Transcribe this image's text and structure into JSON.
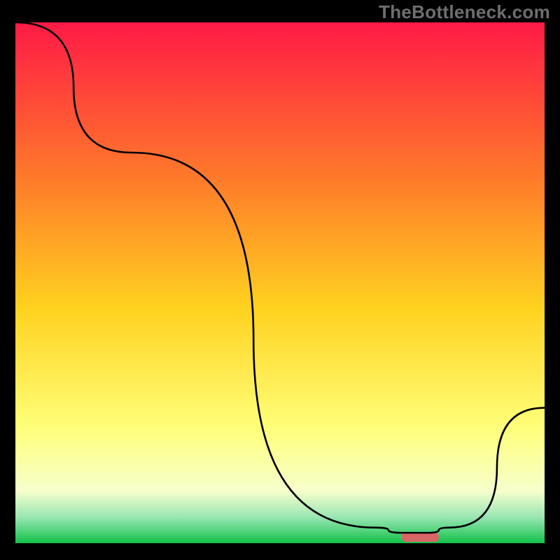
{
  "watermark": "TheBottleneck.com",
  "colors": {
    "frame": "#000000",
    "curve": "#000000",
    "marker": "#d96666",
    "grad_top": "#ff1a46",
    "grad_mid1": "#ff7a2a",
    "grad_mid2": "#ffd21f",
    "grad_mid3": "#ffff7a",
    "grad_mid4": "#f6ffcc",
    "grad_green_top": "#99e6b3",
    "grad_green_bot": "#12c24a"
  },
  "chart_data": {
    "type": "line",
    "title": "",
    "xlabel": "",
    "ylabel": "",
    "xlim": [
      0,
      100
    ],
    "ylim": [
      0,
      100
    ],
    "grid": false,
    "legend": false,
    "x": [
      0,
      22,
      68,
      73,
      78,
      82,
      100
    ],
    "values": [
      100,
      75,
      3,
      2,
      2,
      3,
      26
    ],
    "marker": {
      "x_start": 73,
      "x_end": 80,
      "y": 1.2
    }
  }
}
